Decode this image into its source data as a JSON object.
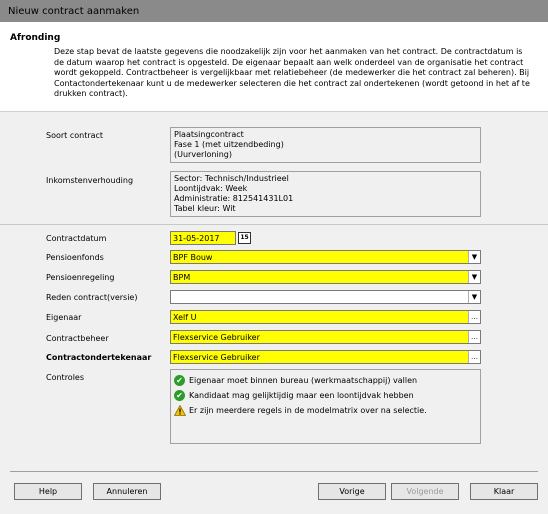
{
  "window": {
    "title": "Nieuw contract aanmaken"
  },
  "header": {
    "title": "Afronding",
    "description": "Deze stap bevat de laatste gegevens die noodzakelijk zijn voor het aanmaken van het contract. De contractdatum is de datum waarop het contract is opgesteld. De eigenaar bepaalt aan welk onderdeel van de organisatie het contract wordt gekoppeld. Contractbeheer is vergelijkbaar met relatiebeheer (de medewerker die het contract zal beheren). Bij Contactondertekenaar kunt u de medewerker selecteren die het contract zal ondertekenen (wordt getoond in het af te drukken contract)."
  },
  "form": {
    "soort_contract": {
      "label": "Soort contract",
      "lines": [
        "Plaatsingcontract",
        "Fase 1 (met uitzendbeding)",
        "(Uurverloning)"
      ]
    },
    "inkomstenverhouding": {
      "label": "Inkomstenverhouding",
      "lines": [
        "Sector: Technisch/Industrieel",
        "Loontijdvak: Week",
        "Administratie: 812541431L01",
        "Tabel kleur: Wit"
      ]
    },
    "contractdatum": {
      "label": "Contractdatum",
      "value": "31-05-2017",
      "calendar_icon": "calendar-icon",
      "calendar_text": "15"
    },
    "pensioenfonds": {
      "label": "Pensioenfonds",
      "value": "BPF Bouw"
    },
    "pensioenregeling": {
      "label": "Pensioenregeling",
      "value": "BPM"
    },
    "reden_contract": {
      "label": "Reden contract(versie)",
      "value": ""
    },
    "eigenaar": {
      "label": "Eigenaar",
      "value": "Xelf U"
    },
    "contractbeheer": {
      "label": "Contractbeheer",
      "value": "Flexservice Gebruiker"
    },
    "contractondertekenaar": {
      "label": "Contractondertekenaar",
      "value": "Flexservice Gebruiker"
    },
    "controles": {
      "label": "Controles",
      "items": [
        {
          "icon": "check-icon",
          "text": "Eigenaar moet binnen bureau (werkmaatschappij) vallen"
        },
        {
          "icon": "check-icon",
          "text": "Kandidaat mag gelijktijdig maar een loontijdvak hebben"
        },
        {
          "icon": "warning-icon",
          "text": "Er zijn meerdere regels in de modelmatrix over na selectie."
        }
      ]
    }
  },
  "icons": {
    "dropdown": "▼",
    "ellipsis": "…",
    "check": "✔"
  },
  "colors": {
    "required_field": "#ffff00",
    "ok": "#2a9d2a",
    "warning": "#f5c400",
    "titlebar": "#8a8a8a"
  },
  "buttons": {
    "help": {
      "label": "Help"
    },
    "cancel": {
      "label": "Annuleren"
    },
    "previous": {
      "label": "Vorige"
    },
    "next": {
      "label": "Volgende",
      "enabled": false
    },
    "finish": {
      "label": "Klaar"
    }
  }
}
